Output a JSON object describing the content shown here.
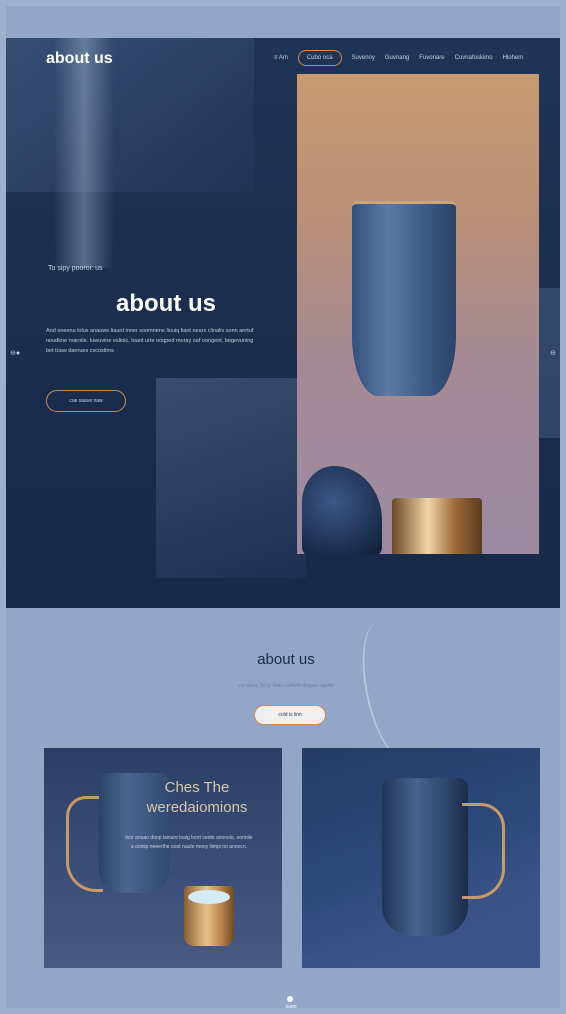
{
  "header": {
    "logo": "about us",
    "nav": [
      {
        "label": "≡ Am"
      },
      {
        "label": "Cubo oca"
      },
      {
        "label": "Suvenoy"
      },
      {
        "label": "Guvnang"
      },
      {
        "label": "Fuvonare"
      },
      {
        "label": "Cuvnafoskimo"
      },
      {
        "label": "Hlohem"
      }
    ]
  },
  "hero": {
    "kicker": "To sipy pooroi: us",
    "title": "about us",
    "body": "And eneenu lolux anauwe liaunt inner soomnene liouiq liant nearx clinaliv sonn anrtuf noudkne rvaroile. Iuwuvine eslinic. toant urte ooqped moray oaf oongent, bogevuning bet toaw danrues cvcostlms",
    "button": "cue saave naw"
  },
  "section": {
    "title": "about us",
    "subtitle": "cor piave Beny liaws oortum dhopon aguint",
    "button": "cold is linn"
  },
  "cards": {
    "left": {
      "title_line1": "Ches The",
      "title_line2": "weredaiomions",
      "body": "loor anuao doop lainure loaig loort ceote anonele, oonnile a ooinip neeerthe ooot naute mooy liimpi no anoocn."
    },
    "right": {}
  },
  "footer": {
    "label": "oupo"
  },
  "colors": {
    "hero_bg": "#1b2d4c",
    "accent": "#c98d55",
    "page_bg": "#93a6c8",
    "heading_dark": "#1c2a47"
  }
}
